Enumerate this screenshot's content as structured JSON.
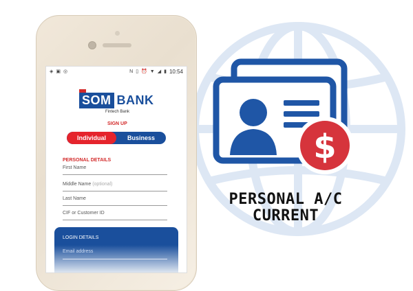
{
  "status_bar": {
    "time": "10:54"
  },
  "app": {
    "logo_som": "SOM",
    "logo_bank": "BANK",
    "tagline": "Fintech Bank",
    "signup_label": "SIGN UP",
    "segment": {
      "individual": "Individual",
      "business": "Business",
      "selected": "Individual"
    },
    "personal_details": {
      "title": "PERSONAL DETAILS",
      "first_name_placeholder": "First Name",
      "middle_name_placeholder": "Middle Name",
      "middle_name_optional": "(optional)",
      "last_name_placeholder": "Last Name",
      "cif_placeholder": "CIF or Customer ID"
    },
    "login_details": {
      "title": "LOGIN DETAILS",
      "email_placeholder": "Email address"
    }
  },
  "headline": {
    "line1": "PERSONAL A/C",
    "line2": "CURRENT"
  },
  "colors": {
    "brand_blue": "#1a4f9c",
    "brand_red": "#e5242c",
    "globe": "#dde7f4",
    "dollar_red": "#d6343c"
  },
  "icons": [
    "globe-icon",
    "id-card-icon",
    "dollar-coin-icon",
    "wifi-icon",
    "battery-icon",
    "alarm-icon"
  ]
}
